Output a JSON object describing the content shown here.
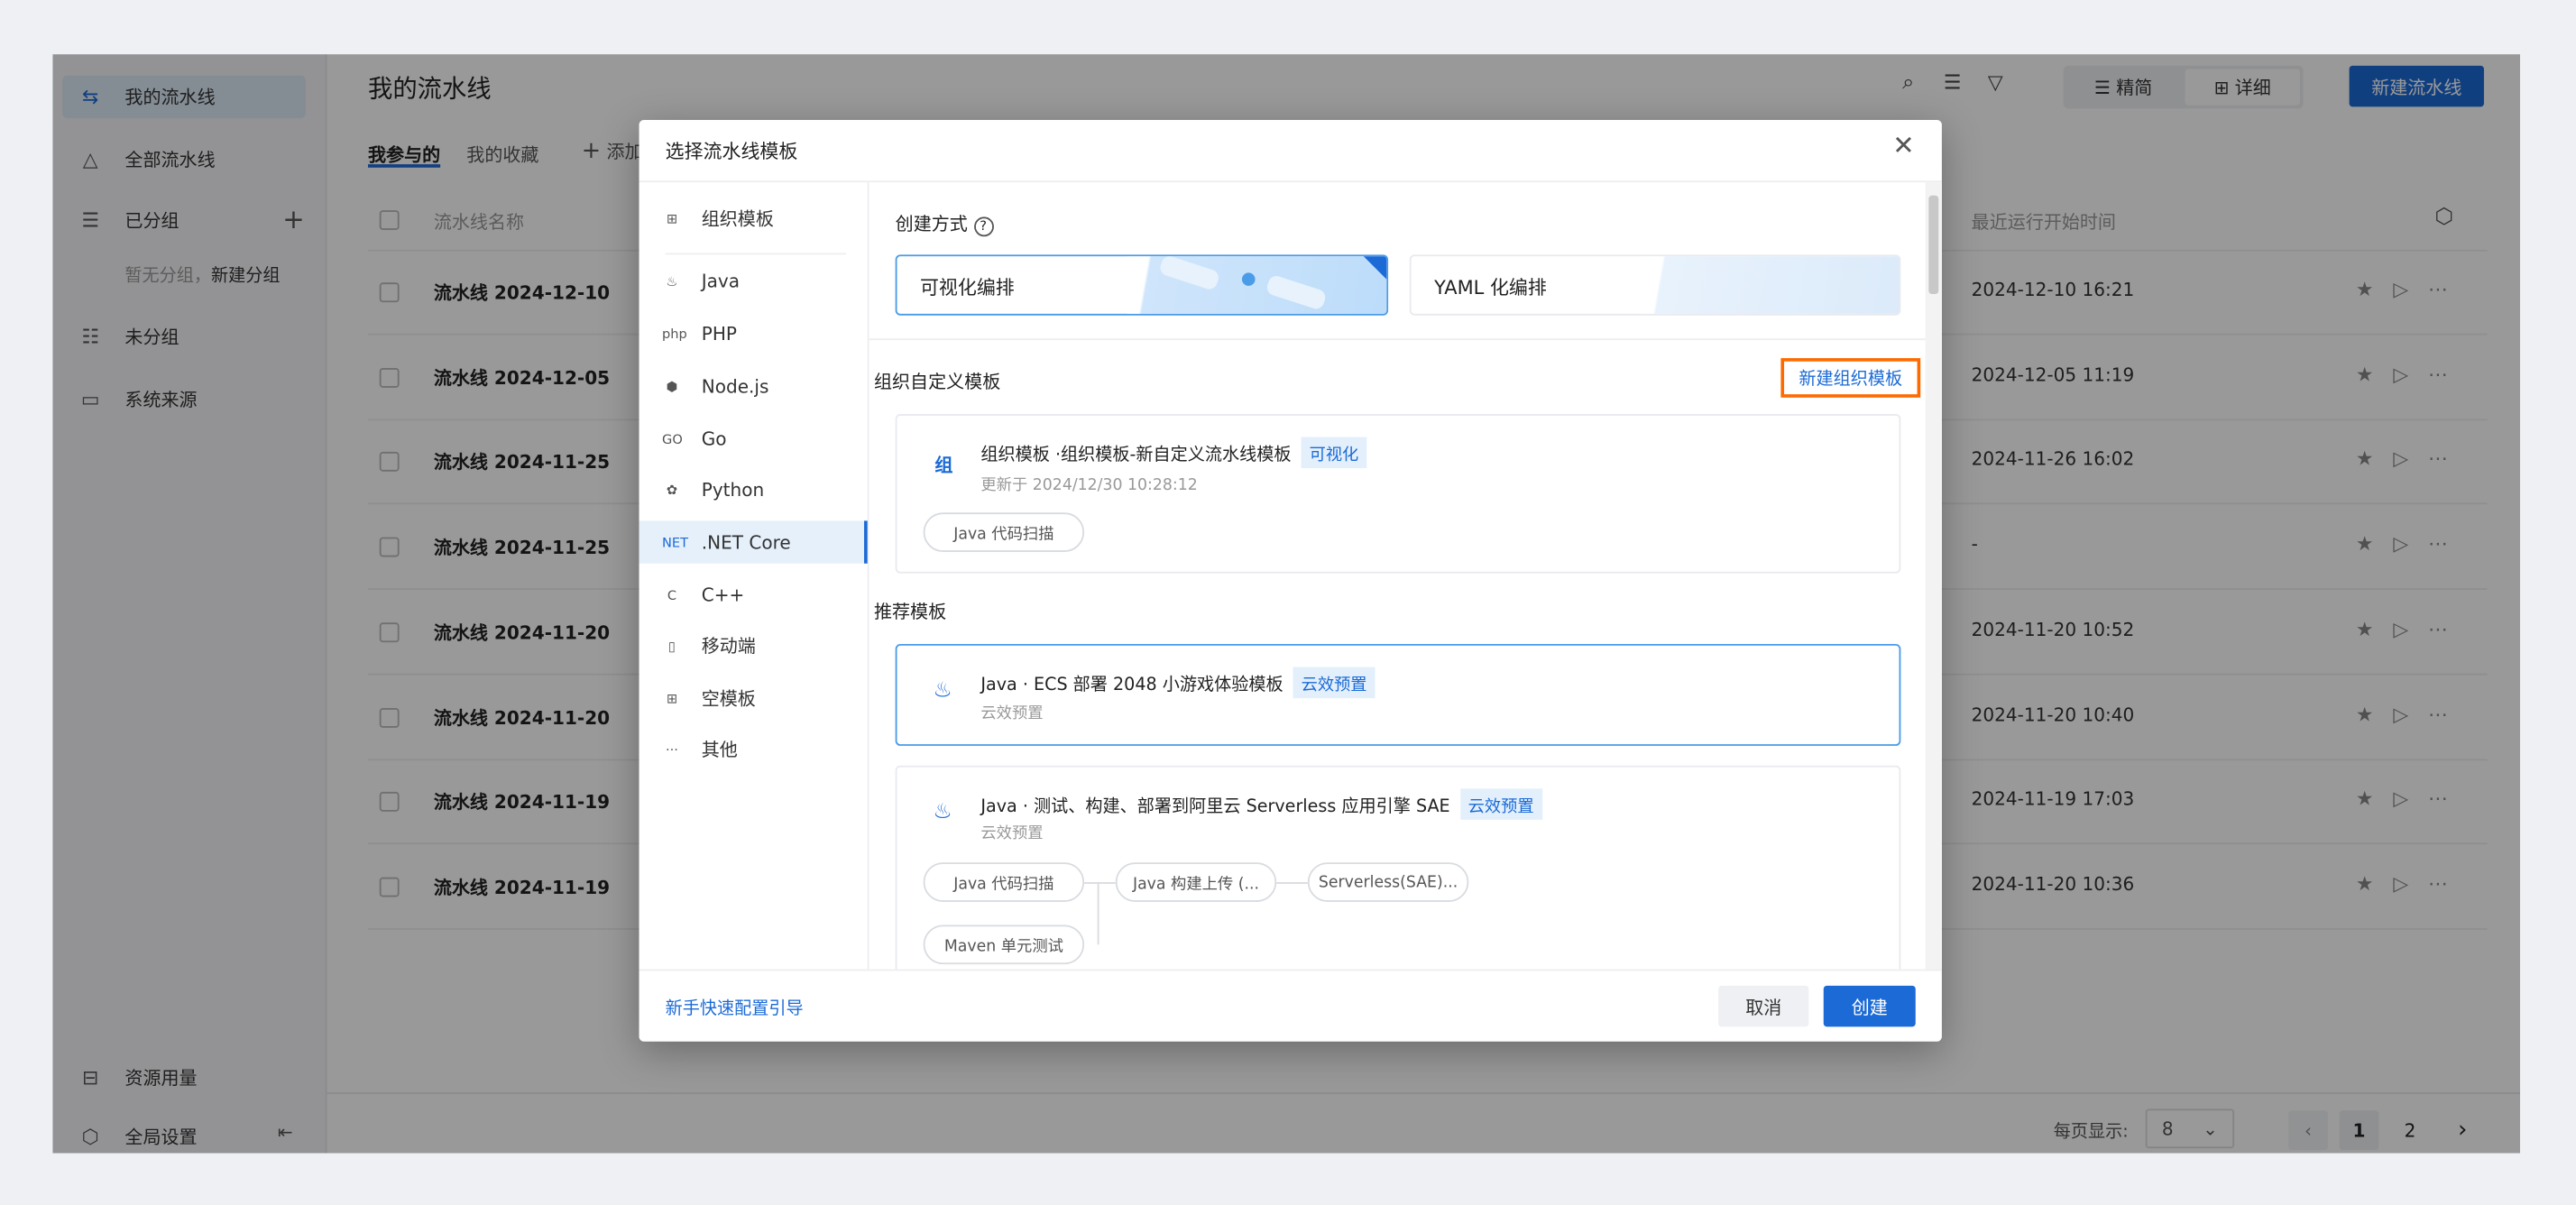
{
  "sidebar": {
    "items": [
      {
        "label": "我的流水线",
        "icon": "pipeline-icon"
      },
      {
        "label": "全部流水线",
        "icon": "nodes-icon"
      },
      {
        "label": "已分组",
        "icon": "group-list-icon"
      },
      {
        "label": "未分组",
        "icon": "ungrouped-icon"
      },
      {
        "label": "系统来源",
        "icon": "monitor-icon"
      }
    ],
    "empty_group": "暂无分组，",
    "new_group": "新建分组",
    "resource_usage": "资源用量",
    "global_settings": "全局设置"
  },
  "header": {
    "title": "我的流水线",
    "tabs": [
      "我参与的",
      "我的收藏"
    ],
    "add_label": "添加",
    "view_simple": "精简",
    "view_detail": "详细",
    "new_pipeline": "新建流水线"
  },
  "table": {
    "col_name": "流水线名称",
    "col_time": "最近运行开始时间",
    "rows": [
      {
        "name": "流水线 2024-12-10",
        "time": "2024-12-10 16:21"
      },
      {
        "name": "流水线 2024-12-05",
        "time": "2024-12-05 11:19"
      },
      {
        "name": "流水线 2024-11-25",
        "time": "2024-11-26 16:02"
      },
      {
        "name": "流水线 2024-11-25",
        "time": "-"
      },
      {
        "name": "流水线 2024-11-20",
        "time": "2024-11-20 10:52"
      },
      {
        "name": "流水线 2024-11-20",
        "time": "2024-11-20 10:40"
      },
      {
        "name": "流水线 2024-11-19",
        "time": "2024-11-19 17:03"
      },
      {
        "name": "流水线 2024-11-19",
        "time": "2024-11-20 10:36"
      }
    ]
  },
  "pagination": {
    "page_size_label": "每页显示:",
    "page_size": "8",
    "pages": [
      "1",
      "2"
    ],
    "current": "1"
  },
  "modal": {
    "title": "选择流水线模板",
    "nav": [
      {
        "label": "组织模板",
        "icon": "grid-icon"
      },
      {
        "label": "Java",
        "icon": "java-icon"
      },
      {
        "label": "PHP",
        "icon": "php-icon"
      },
      {
        "label": "Node.js",
        "icon": "nodejs-icon"
      },
      {
        "label": "Go",
        "icon": "go-icon"
      },
      {
        "label": "Python",
        "icon": "python-icon"
      },
      {
        "label": ".NET Core",
        "icon": "dotnet-icon",
        "active": true
      },
      {
        "label": "C++",
        "icon": "cpp-icon"
      },
      {
        "label": "移动端",
        "icon": "mobile-icon"
      },
      {
        "label": "空模板",
        "icon": "empty-template-icon"
      },
      {
        "label": "其他",
        "icon": "more-icon"
      }
    ],
    "create_mode_label": "创建方式",
    "mode_visual": "可视化编排",
    "mode_yaml": "YAML 化编排",
    "org_section": "组织自定义模板",
    "new_org_template": "新建组织模板",
    "org_template": {
      "badge": "组",
      "title": "组织模板 ·组织模板-新自定义流水线模板",
      "tag": "可视化",
      "updated": "更新于 2024/12/30 10:28:12",
      "chips": [
        "Java 代码扫描"
      ]
    },
    "recommended_section": "推荐模板",
    "recommended": [
      {
        "title": "Java · ECS 部署 2048 小游戏体验模板",
        "tag": "云效预置",
        "sub": "云效预置"
      },
      {
        "title": "Java · 测试、构建、部署到阿里云 Serverless 应用引擎 SAE",
        "tag": "云效预置",
        "sub": "云效预置",
        "chips": [
          "Java 代码扫描",
          "Java 构建上传 (...",
          "Serverless(SAE)...",
          "Maven 单元测试"
        ]
      }
    ],
    "guide_link": "新手快速配置引导",
    "cancel": "取消",
    "create": "创建"
  },
  "colors": {
    "primary": "#1b6ad6",
    "highlight_box": "#ff6a00"
  }
}
